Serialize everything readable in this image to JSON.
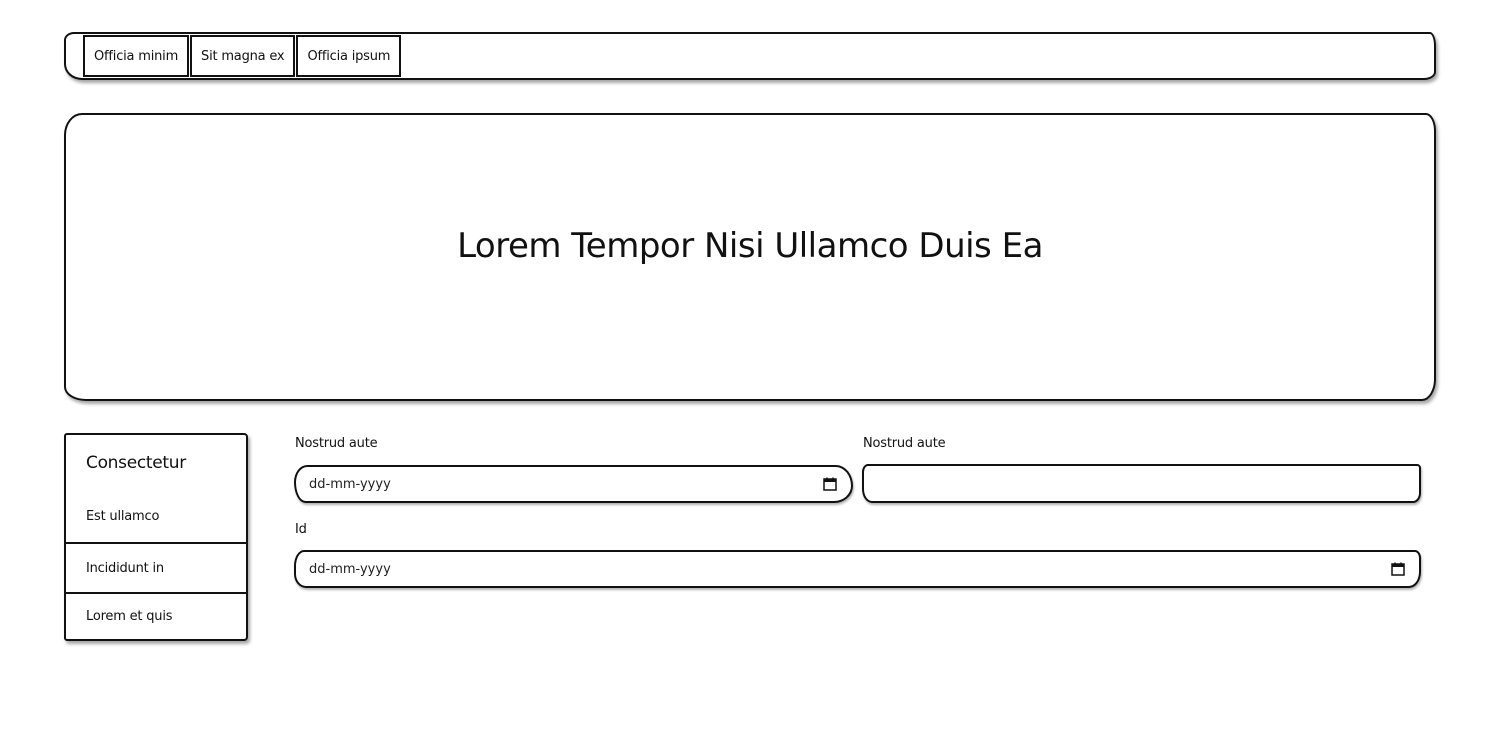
{
  "nav": {
    "tabs": [
      {
        "label": "Officia minim"
      },
      {
        "label": "Sit magna ex"
      },
      {
        "label": "Officia ipsum"
      }
    ]
  },
  "hero": {
    "title": "Lorem Tempor Nisi Ullamco Duis Ea"
  },
  "sidebar": {
    "heading": "Consectetur",
    "items": [
      {
        "label": "Est ullamco"
      },
      {
        "label": "Incididunt in"
      },
      {
        "label": "Lorem et quis"
      }
    ]
  },
  "form": {
    "field1": {
      "label": "Nostrud aute",
      "placeholder": "dd-mm-yyyy",
      "icon": "calendar-icon"
    },
    "field2": {
      "label": "Nostrud aute",
      "value": ""
    },
    "field3": {
      "label": "Id",
      "placeholder": "dd-mm-yyyy",
      "icon": "calendar-icon"
    }
  }
}
